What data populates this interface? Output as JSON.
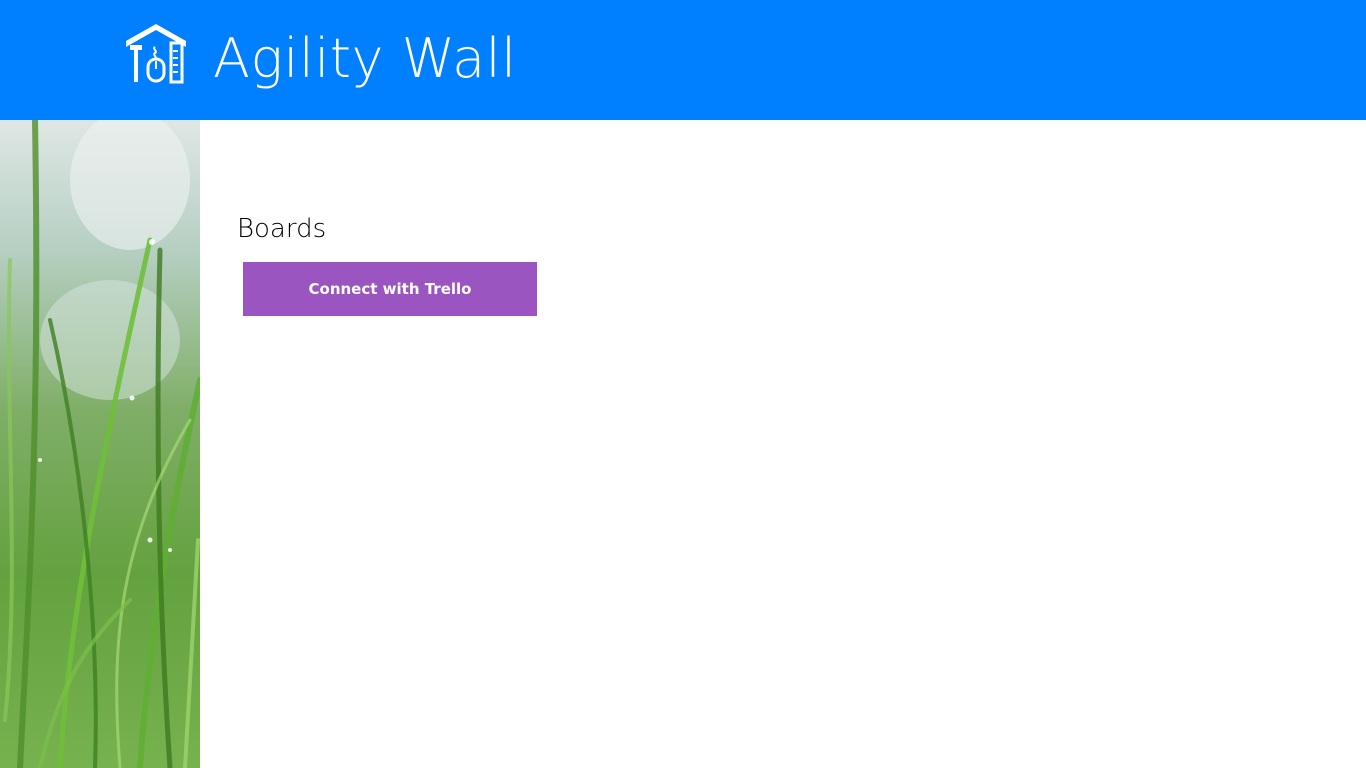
{
  "app": {
    "title": "Agility Wall",
    "logo_icon": "house-tools-icon"
  },
  "colors": {
    "header": "#0080ff",
    "button": "#9b55c0",
    "button_text": "#ffffff",
    "background": "#ffffff"
  },
  "side_panel": {
    "image": "grass-photo"
  },
  "main": {
    "section_title": "Boards",
    "connect_button_label": "Connect with Trello"
  }
}
